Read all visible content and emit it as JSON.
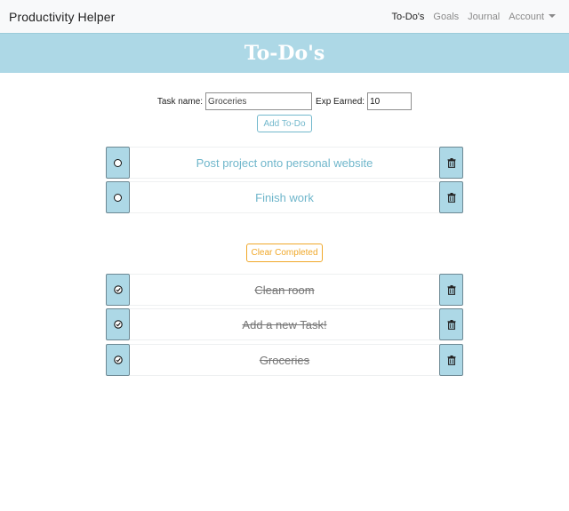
{
  "nav": {
    "brand": "Productivity Helper",
    "links": [
      {
        "label": "To-Do's",
        "active": true
      },
      {
        "label": "Goals",
        "active": false
      },
      {
        "label": "Journal",
        "active": false
      },
      {
        "label": "Account",
        "active": false
      }
    ]
  },
  "banner": {
    "title": "To-Do's"
  },
  "form": {
    "task_label": "Task name:",
    "task_value": "Groceries",
    "exp_label": "Exp Earned:",
    "exp_value": "10",
    "add_button": "Add To-Do"
  },
  "pending": [
    {
      "text": "Post project onto personal website"
    },
    {
      "text": "Finish work"
    }
  ],
  "clear_button": "Clear Completed",
  "completed": [
    {
      "text": "Clean room"
    },
    {
      "text": "Add a new Task!"
    },
    {
      "text": "Groceries"
    }
  ],
  "colors": {
    "banner": "#add8e6",
    "accent_blue": "#72b8cc",
    "accent_orange": "#f0a82a"
  },
  "icons": {
    "pending_toggle": "circle-icon",
    "completed_toggle": "check-circle-icon",
    "delete": "trash-icon"
  }
}
